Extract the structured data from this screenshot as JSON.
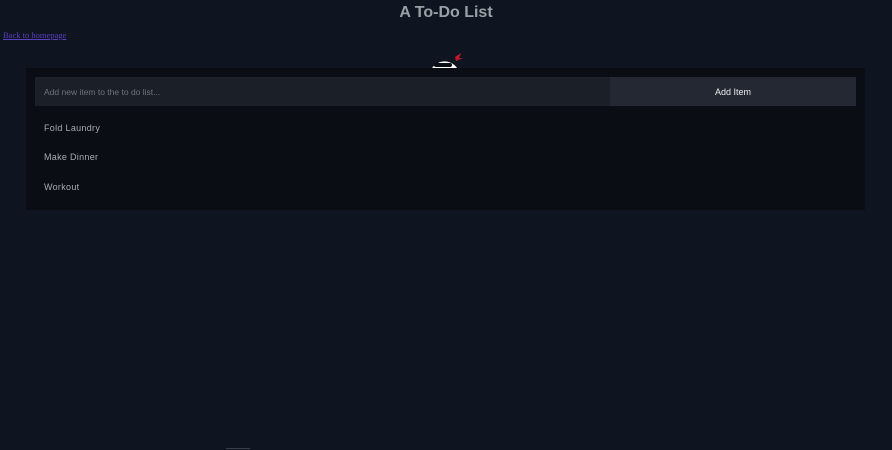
{
  "page": {
    "title": "A To-Do List",
    "back_link": "Back to homepage"
  },
  "mascot": {
    "icon": "ninja-mascot-icon",
    "accent_color": "#c0182b"
  },
  "add_form": {
    "input_value": "",
    "input_placeholder": "Add new item to the to do list...",
    "button_label": "Add Item"
  },
  "todos": [
    {
      "label": "Fold Laundry"
    },
    {
      "label": "Make Dinner"
    },
    {
      "label": "Workout"
    }
  ],
  "colors": {
    "background": "#0f1520",
    "panel": "#0a0d13",
    "input_bg": "#1b1f27",
    "button_bg": "#242832",
    "link": "#5a3fc0"
  }
}
